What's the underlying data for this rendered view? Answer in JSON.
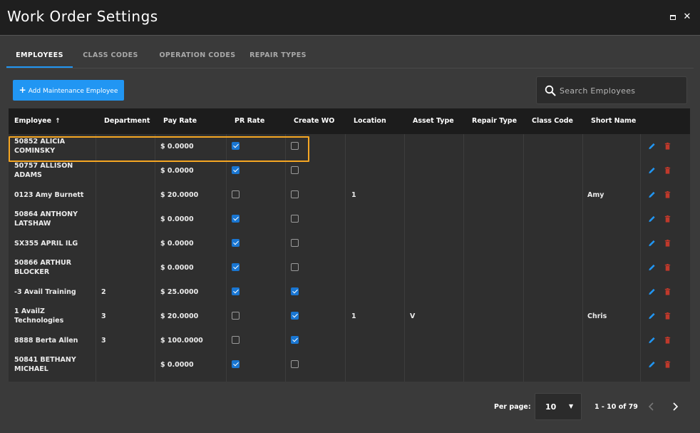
{
  "window": {
    "title": "Work Order Settings"
  },
  "tabs": [
    {
      "label": "EMPLOYEES",
      "active": true
    },
    {
      "label": "CLASS CODES",
      "active": false
    },
    {
      "label": "OPERATION CODES",
      "active": false
    },
    {
      "label": "REPAIR TYPES",
      "active": false
    }
  ],
  "toolbar": {
    "add_label": "Add Maintenance Employee",
    "add_icon": "plus-icon"
  },
  "search": {
    "placeholder": "Search Employees",
    "value": ""
  },
  "table": {
    "columns": [
      "Employee",
      "Department",
      "Pay Rate",
      "PR Rate",
      "Create WO",
      "Location",
      "Asset Type",
      "Repair Type",
      "Class Code",
      "Short Name"
    ],
    "sort_indicator": "↑",
    "rows": [
      {
        "employee": [
          "50852 ALICIA",
          "COMINSKY"
        ],
        "department": "",
        "pay_rate": "$ 0.0000",
        "pr_rate": true,
        "create_wo": false,
        "location": "",
        "asset_type": "",
        "repair_type": "",
        "class_code": "",
        "short_name": ""
      },
      {
        "employee": [
          "50757 ALLISON",
          "ADAMS"
        ],
        "department": "",
        "pay_rate": "$ 0.0000",
        "pr_rate": true,
        "create_wo": false,
        "location": "",
        "asset_type": "",
        "repair_type": "",
        "class_code": "",
        "short_name": ""
      },
      {
        "employee": [
          "0123 Amy Burnett"
        ],
        "department": "",
        "pay_rate": "$ 20.0000",
        "pr_rate": false,
        "create_wo": false,
        "location": "1",
        "asset_type": "",
        "repair_type": "",
        "class_code": "",
        "short_name": "Amy"
      },
      {
        "employee": [
          "50864 ANTHONY",
          "LATSHAW"
        ],
        "department": "",
        "pay_rate": "$ 0.0000",
        "pr_rate": true,
        "create_wo": false,
        "location": "",
        "asset_type": "",
        "repair_type": "",
        "class_code": "",
        "short_name": ""
      },
      {
        "employee": [
          "SX355 APRIL ILG"
        ],
        "department": "",
        "pay_rate": "$ 0.0000",
        "pr_rate": true,
        "create_wo": false,
        "location": "",
        "asset_type": "",
        "repair_type": "",
        "class_code": "",
        "short_name": ""
      },
      {
        "employee": [
          "50866 ARTHUR",
          "BLOCKER"
        ],
        "department": "",
        "pay_rate": "$ 0.0000",
        "pr_rate": true,
        "create_wo": false,
        "location": "",
        "asset_type": "",
        "repair_type": "",
        "class_code": "",
        "short_name": ""
      },
      {
        "employee": [
          "-3 Avail Training"
        ],
        "department": "2",
        "pay_rate": "$ 25.0000",
        "pr_rate": true,
        "create_wo": true,
        "location": "",
        "asset_type": "",
        "repair_type": "",
        "class_code": "",
        "short_name": ""
      },
      {
        "employee": [
          "1 AvailZ",
          "Technologies"
        ],
        "department": "3",
        "pay_rate": "$ 20.0000",
        "pr_rate": false,
        "create_wo": true,
        "location": "1",
        "asset_type": "V",
        "repair_type": "",
        "class_code": "",
        "short_name": "Chris"
      },
      {
        "employee": [
          "8888 Berta Allen"
        ],
        "department": "3",
        "pay_rate": "$ 100.0000",
        "pr_rate": false,
        "create_wo": true,
        "location": "",
        "asset_type": "",
        "repair_type": "",
        "class_code": "",
        "short_name": ""
      },
      {
        "employee": [
          "50841 BETHANY",
          "MICHAEL"
        ],
        "department": "",
        "pay_rate": "$ 0.0000",
        "pr_rate": true,
        "create_wo": false,
        "location": "",
        "asset_type": "",
        "repair_type": "",
        "class_code": "",
        "short_name": ""
      }
    ]
  },
  "pagination": {
    "per_page_label": "Per page:",
    "per_page_value": "10",
    "range_label": "1 - 10 of 79"
  },
  "colors": {
    "accent": "#2196f3",
    "highlight": "#f5a623",
    "delete": "#c0392b",
    "edit": "#2196f3"
  }
}
